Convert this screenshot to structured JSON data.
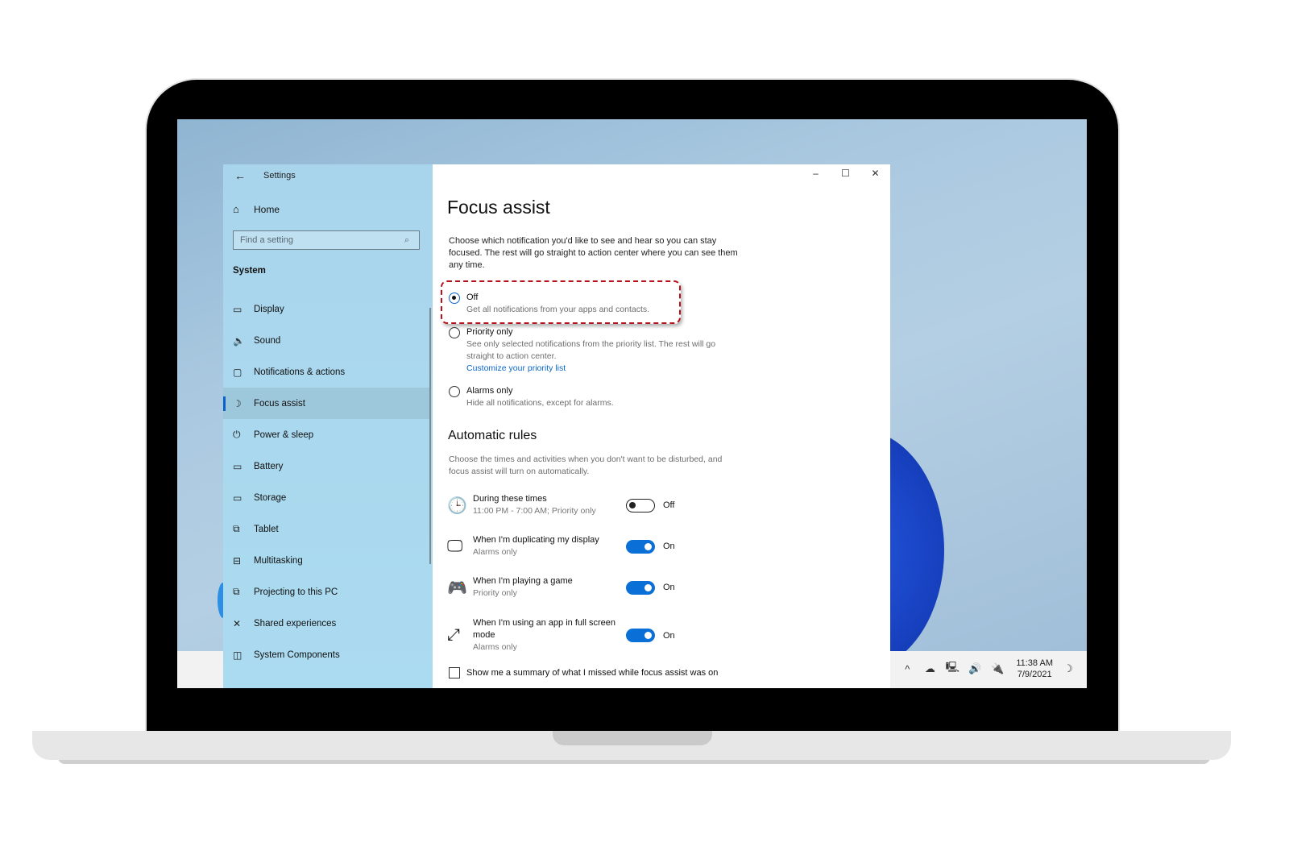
{
  "window": {
    "title": "Settings",
    "controls": {
      "minimize": "–",
      "maximize": "☐",
      "close": "✕"
    }
  },
  "sidebar": {
    "back_icon": "←",
    "home": {
      "icon": "⌂",
      "label": "Home"
    },
    "search": {
      "placeholder": "Find a setting",
      "value": "",
      "icon": "⌕"
    },
    "section": "System",
    "items": [
      {
        "icon": "▭",
        "label": "Display",
        "active": false
      },
      {
        "icon": "🔈",
        "label": "Sound",
        "active": false
      },
      {
        "icon": "▢",
        "label": "Notifications & actions",
        "active": false
      },
      {
        "icon": "☽",
        "label": "Focus assist",
        "active": true
      },
      {
        "icon": "⏻",
        "label": "Power & sleep",
        "active": false
      },
      {
        "icon": "▭",
        "label": "Battery",
        "active": false
      },
      {
        "icon": "▭",
        "label": "Storage",
        "active": false
      },
      {
        "icon": "⧉",
        "label": "Tablet",
        "active": false
      },
      {
        "icon": "⊟",
        "label": "Multitasking",
        "active": false
      },
      {
        "icon": "⧉",
        "label": "Projecting to this PC",
        "active": false
      },
      {
        "icon": "✕",
        "label": "Shared experiences",
        "active": false
      },
      {
        "icon": "◫",
        "label": "System Components",
        "active": false
      }
    ]
  },
  "main": {
    "title": "Focus assist",
    "intro": "Choose which notification you'd like to see and hear so you can stay focused. The rest will go straight to action center where you can see them any time.",
    "options": [
      {
        "label": "Off",
        "description": "Get all notifications from your apps and contacts.",
        "selected": true
      },
      {
        "label": "Priority only",
        "description": "See only selected notifications from the priority list. The rest will go straight to action center.",
        "link": "Customize your priority list",
        "selected": false
      },
      {
        "label": "Alarms only",
        "description": "Hide all notifications, except for alarms.",
        "selected": false
      }
    ],
    "automatic_rules": {
      "title": "Automatic rules",
      "description": "Choose the times and activities when you don't want to be disturbed, and focus assist will turn on automatically.",
      "rules": [
        {
          "icon": "🕒",
          "title": "During these times",
          "subtitle": "11:00 PM - 7:00 AM; Priority only",
          "state": "Off",
          "on": false
        },
        {
          "icon": "🖵",
          "title": "When I'm duplicating my display",
          "subtitle": "Alarms only",
          "state": "On",
          "on": true
        },
        {
          "icon": "🎮",
          "title": "When I'm playing a game",
          "subtitle": "Priority only",
          "state": "On",
          "on": true
        },
        {
          "icon": "⤢",
          "title": "When I'm using an app in full screen mode",
          "subtitle": "Alarms only",
          "state": "On",
          "on": true
        }
      ]
    },
    "summary_checkbox": {
      "label": "Show me a summary of what I missed while focus assist was on",
      "checked": false
    }
  },
  "taskbar": {
    "tray_icons": [
      "^",
      "☁",
      "🖳",
      "🔊",
      "🔌"
    ],
    "time": "11:38 AM",
    "date": "7/9/2021",
    "focus_icon": "☽"
  },
  "colors": {
    "accent": "#0a6fd6",
    "highlight_border": "#b5121b",
    "link": "#0a66cc"
  }
}
